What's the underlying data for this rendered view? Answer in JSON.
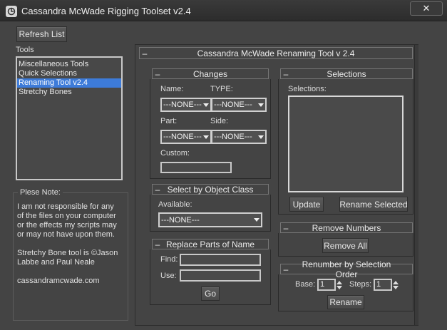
{
  "window": {
    "title": "Cassandra McWade Rigging Toolset v2.4",
    "close_glyph": "✕"
  },
  "left": {
    "refresh_button": "Refresh List",
    "tools_label": "Tools",
    "tools": [
      "Miscellaneous Tools",
      "Quick Selections",
      "Renaming Tool v2.4",
      "Stretchy Bones"
    ],
    "selected_tool": "Renaming Tool v2.4",
    "note": {
      "legend": "Plese Note:",
      "lines": [
        "I am not responsible for any",
        "of the files on your computer",
        "or the effects my scripts may",
        "or may not have upon them.",
        "",
        "Stretchy Bone tool is ©Jason",
        "Labbe and Paul Neale",
        "",
        "cassandramcwade.com"
      ]
    }
  },
  "rollout": {
    "title": "Cassandra McWade Renaming Tool v 2.4",
    "minus": "–"
  },
  "changes": {
    "title": "Changes",
    "name_label": "Name:",
    "type_label": "TYPE:",
    "part_label": "Part:",
    "side_label": "Side:",
    "custom_label": "Custom:",
    "name_value": "---NONE---",
    "type_value": "---NONE---",
    "part_value": "---NONE---",
    "side_value": "---NONE---",
    "custom_value": ""
  },
  "select_class": {
    "title": "Select by Object Class",
    "available_label": "Available:",
    "available_value": "---NONE---"
  },
  "replace": {
    "title": "Replace Parts of Name",
    "find_label": "Find:",
    "use_label": "Use:",
    "go_button": "Go"
  },
  "selections": {
    "title": "Selections",
    "label": "Selections:",
    "update_button": "Update",
    "rename_selected_button": "Rename Selected"
  },
  "remove_numbers": {
    "title": "Remove Numbers",
    "remove_all_button": "Remove All"
  },
  "renumber": {
    "title": "Renumber by Selection Order",
    "base_label": "Base:",
    "base_value": "1",
    "steps_label": "Steps:",
    "steps_value": "1",
    "rename_button": "Rename"
  },
  "icons": {
    "app": "app-logo-icon",
    "close": "close-icon",
    "dropdown": "chevron-down-icon",
    "spinner": "spinner-arrows-icon"
  }
}
